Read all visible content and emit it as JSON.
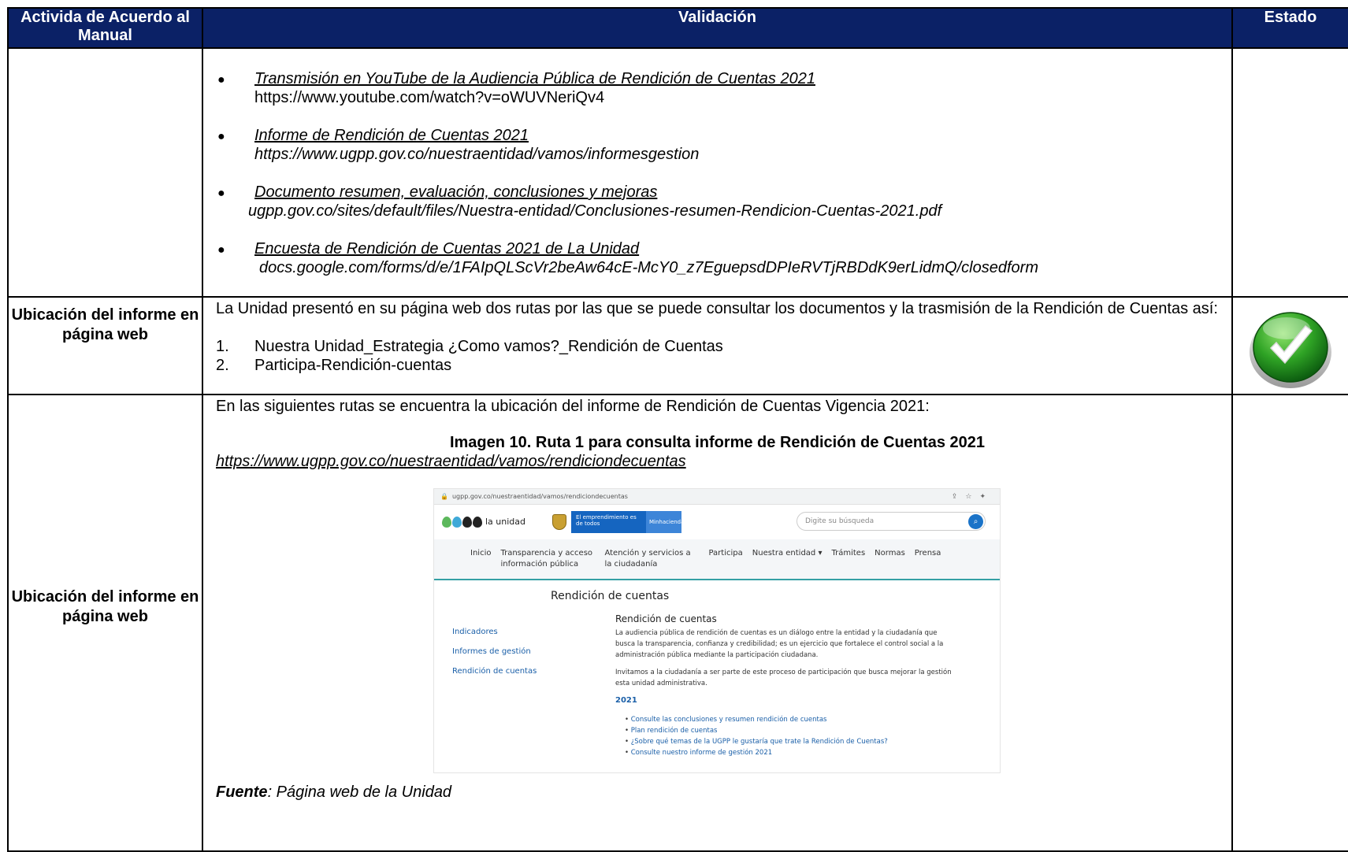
{
  "table": {
    "headers": [
      "Activida de Acuerdo al Manual",
      "Validación",
      "Estado"
    ]
  },
  "row1": {
    "items": [
      {
        "title": "Transmisión en YouTube de la Audiencia Pública de Rendición de Cuentas 2021",
        "url": "https://www.youtube.com/watch?v=oWUVNeriQv4"
      },
      {
        "title": "Informe de Rendición de Cuentas 2021",
        "url": "https://www.ugpp.gov.co/nuestraentidad/vamos/informesgestion"
      },
      {
        "title": "Documento resumen, evaluación, conclusiones y mejoras",
        "url": "ugpp.gov.co/sites/default/files/Nuestra-entidad/Conclusiones-resumen-Rendicion-Cuentas-2021.pdf"
      },
      {
        "title": "Encuesta de Rendición de Cuentas 2021 de La Unidad",
        "url": "docs.google.com/forms/d/e/1FAIpQLScVr2beAw64cE-McY0_z7EguepsdDPIeRVTjRBDdK9erLidmQ/closedform"
      }
    ]
  },
  "row2": {
    "label": "Ubicación del informe en página web",
    "paragraph": "La Unidad presentó en su página web dos rutas por las que se puede consultar los documentos y la trasmisión de la Rendición de Cuentas así:",
    "list": [
      {
        "num": "1.",
        "text": "Nuestra Unidad_Estrategia ¿Como vamos?_Rendición de Cuentas"
      },
      {
        "num": "2.",
        "text": "Participa-Rendición-cuentas"
      }
    ],
    "status_icon": "green-check-icon"
  },
  "row3": {
    "label": "Ubicación del informe en página web",
    "intro": "En las siguientes rutas se encuentra la ubicación del informe de Rendición de Cuentas Vigencia 2021:",
    "caption": "Imagen 10. Ruta 1 para consulta informe de Rendición de Cuentas 2021",
    "link": "https://www.ugpp.gov.co/nuestraentidad/vamos/rendiciondecuentas",
    "source_label": "Fuente",
    "source_text": ": Página web de la Unidad"
  },
  "screenshot": {
    "address": "ugpp.gov.co/nuestraentidad/vamos/rendiciondecuentas",
    "logo_text": "la unidad",
    "banner_main": "El emprendimiento es de todos",
    "banner_side": "Minhacienda",
    "search_placeholder": "Digite su búsqueda",
    "nav": [
      "Inicio",
      "Transparencia y acceso información pública",
      "Atención y servicios a la ciudadanía",
      "Participa",
      "Nuestra entidad ▾",
      "Trámites",
      "Normas",
      "Prensa"
    ],
    "page_title": "Rendición de cuentas",
    "side_links": [
      "Indicadores",
      "Informes de gestión",
      "Rendición de cuentas"
    ],
    "main_heading": "Rendición de cuentas",
    "p1": "La audiencia pública de rendición de cuentas es un diálogo entre la entidad y la ciudadanía que busca la transparencia, confianza y credibilidad; es un ejercicio que fortalece el control social a la administración pública mediante la participación ciudadana.",
    "p2": "Invitamos a la ciudadanía a ser parte de este proceso de participación que busca mejorar la gestión esta unidad administrativa.",
    "year": "2021",
    "links": [
      "Consulte las conclusiones y resumen rendición de cuentas",
      "Plan rendición de cuentas",
      "¿Sobre qué temas de la UGPP le gustaría que trate la Rendición de Cuentas?",
      "Consulte nuestro informe de gestión 2021"
    ]
  }
}
